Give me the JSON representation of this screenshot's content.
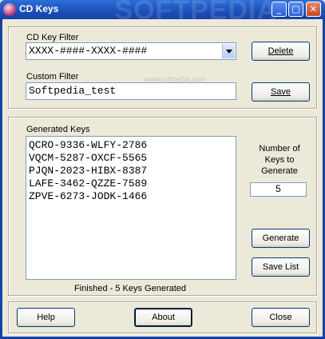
{
  "window": {
    "title": "CD Keys",
    "watermark": "SOFTPEDIA",
    "sub_watermark": "www.softpedia.com"
  },
  "titlebar": {
    "minimize": "_",
    "maximize": "□",
    "close": "✕"
  },
  "filter": {
    "cd_key_label": "CD Key Filter",
    "cd_key_value": "XXXX-####-XXXX-####",
    "delete_label": "Delete",
    "custom_label": "Custom Filter",
    "custom_value": "Softpedia_test",
    "save_label": "Save"
  },
  "generated": {
    "label": "Generated Keys",
    "keys": [
      "QCRO-9336-WLFY-2786",
      "VQCM-5287-OXCF-5565",
      "PJQN-2023-HIBX-8387",
      "LAFE-3462-QZZE-7589",
      "ZPVE-6273-JODK-1466"
    ],
    "number_label_1": "Number of",
    "number_label_2": "Keys to",
    "number_label_3": "Generate",
    "number_value": "5",
    "generate_label": "Generate",
    "save_list_label": "Save List",
    "status": "Finished - 5 Keys Generated"
  },
  "footer": {
    "help_label": "Help",
    "about_label": "About",
    "close_label": "Close"
  }
}
